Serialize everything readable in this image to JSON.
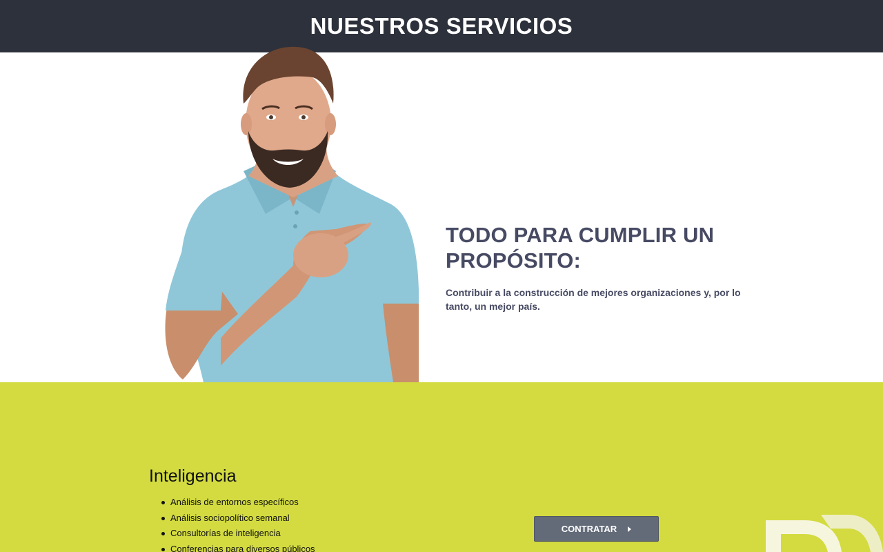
{
  "header": {
    "title": "NUESTROS SERVICIOS"
  },
  "hero": {
    "title_line1": "TODO PARA CUMPLIR UN",
    "title_line2": "PROPÓSITO:",
    "subtitle_line1": "Contribuir a la construcción de mejores organizaciones y, por lo",
    "subtitle_line2": "tanto, un mejor país.",
    "image": "smiling-man-pointing"
  },
  "services": {
    "heading": "Inteligencia",
    "items": [
      "Análisis de entornos específicos",
      "Análisis sociopolítico semanal",
      "Consultorías de inteligencia",
      "Conferencias para diversos públicos"
    ],
    "button_label": "CONTRATAR",
    "button_icon": "caret-right-icon"
  },
  "colors": {
    "header_bg": "#2d313b",
    "title_color": "#474a63",
    "section_bg": "#d3db40",
    "button_bg": "#636b79",
    "brand_mark": "#f3f3d6"
  }
}
